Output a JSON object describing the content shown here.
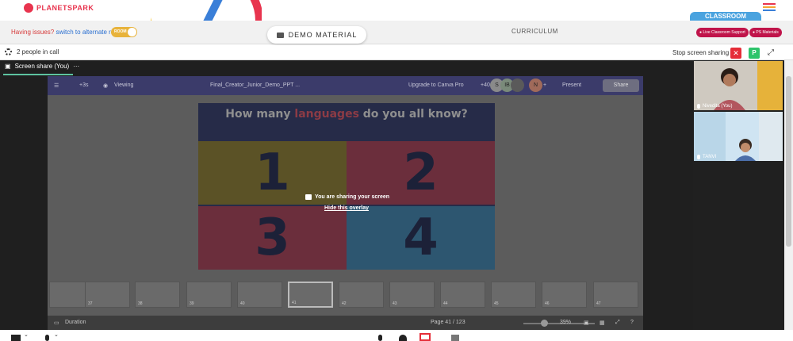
{
  "brand": {
    "logo_text": "PLANETSPARK"
  },
  "header": {
    "classroom_tab": "CLASSROOM",
    "issue_text": "Having issues?",
    "alternate_room_link": "switch to alternate room",
    "room_toggle_label": "ROOM",
    "demo_material": "DEMO MATERIAL",
    "curriculum": "CURRICULUM",
    "live_support": "Live Classroom Support",
    "ps_materials": "PS Materials"
  },
  "call_bar": {
    "people_in_call": "2 people in call",
    "stop_screen_sharing": "Stop screen sharing",
    "stop_icon": "close-icon",
    "participant_badge": "P",
    "fullscreen_icon": "expand-icon"
  },
  "screen_share": {
    "tab_label": "Screen share (You)",
    "tab_menu": "···",
    "overlay_message": "You are sharing your screen",
    "hide_overlay": "Hide this overlay"
  },
  "canva": {
    "topbar": {
      "undo_count": "+3s",
      "viewing": "Viewing",
      "file_name": "Final_Creator_Junior_Demo_PPT ...",
      "upgrade": "Upgrade to Canva Pro",
      "avatar_count": "+40",
      "avatars": [
        "S",
        "IB",
        "",
        "N"
      ],
      "plus": "+",
      "present": "Present",
      "share": "Share"
    },
    "slide": {
      "title_prefix": "How many",
      "title_accent": "languages",
      "title_suffix": "do you all know?",
      "quadrants": [
        {
          "label": "1",
          "color": "#5b5226"
        },
        {
          "label": "2",
          "color": "#6b2e3c"
        },
        {
          "label": "3",
          "color": "#6b2e3c"
        },
        {
          "label": "4",
          "color": "#2d5670"
        }
      ]
    },
    "thumbnails": [
      {
        "num": ""
      },
      {
        "num": "37"
      },
      {
        "num": "38"
      },
      {
        "num": "39"
      },
      {
        "num": "40"
      },
      {
        "num": "41"
      },
      {
        "num": "42"
      },
      {
        "num": "43"
      },
      {
        "num": "44"
      },
      {
        "num": "45"
      },
      {
        "num": "46"
      },
      {
        "num": "47"
      }
    ],
    "bottombar": {
      "duration": "Duration",
      "page": "Page 41 / 123",
      "zoom": "39%"
    }
  },
  "participants": [
    {
      "name": "Nivedita (You)"
    },
    {
      "name": "TANVI"
    }
  ],
  "colors": {
    "brand_red": "#e8344e",
    "stop_red": "#e52d38",
    "participant_green": "#2ec46b",
    "classroom_blue": "#4aa3df",
    "support_pill": "#c0144a"
  }
}
